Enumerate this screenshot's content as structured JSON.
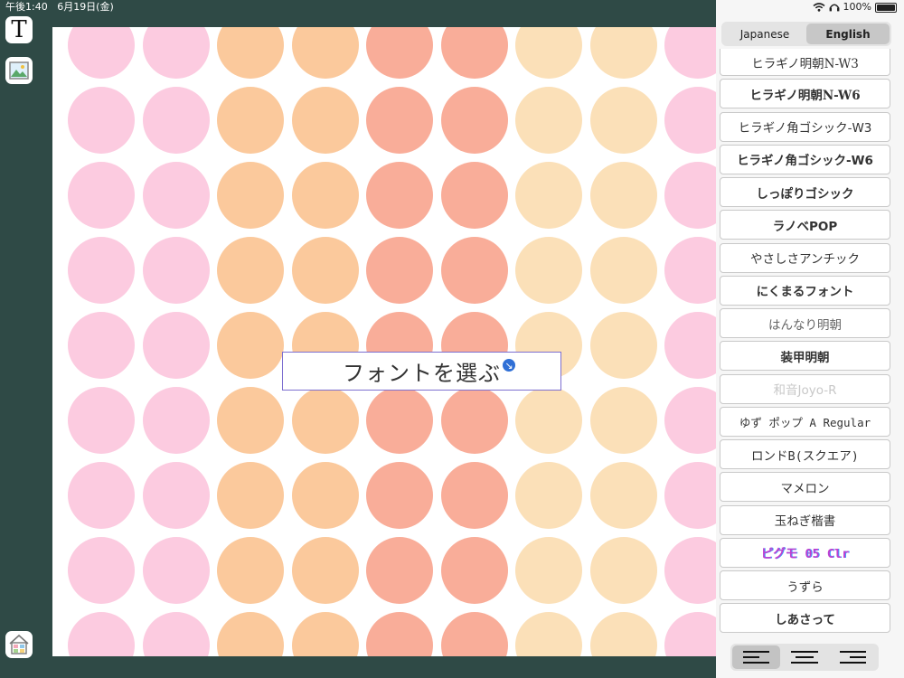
{
  "status_bar": {
    "time": "午後1:40   6月19日(金)",
    "battery": "100%"
  },
  "tools": {
    "text_tool_label": "T"
  },
  "canvas": {
    "text_box": "フォントを選ぶ",
    "dot_colors": [
      "#fccbe0",
      "#fccbe0",
      "#fbc99c",
      "#fbc99c",
      "#f9ad99",
      "#f9ad99",
      "#fbe0b8",
      "#fbe0b8",
      "#fccbe0"
    ]
  },
  "language_toggle": {
    "options": [
      "Japanese",
      "English"
    ],
    "selected": "English"
  },
  "fonts": [
    "ヒラギノ明朝N-W3",
    "ヒラギノ明朝N-W6",
    "ヒラギノ角ゴシック-W3",
    "ヒラギノ角ゴシック-W6",
    "しっぽりゴシック",
    "ラノベPOP",
    "やさしさアンチック",
    "にくまるフォント",
    "はんなり明朝",
    "装甲明朝",
    "和音Joyo-R",
    "ゆず  ポップ A Regular",
    "ロンドB(スクエア)",
    "マメロン",
    "玉ねぎ楷書",
    "ピグモ 05 Clr",
    "うずら",
    "しあさって"
  ],
  "alignment": {
    "options": [
      "left",
      "center",
      "right"
    ],
    "selected": "left"
  }
}
